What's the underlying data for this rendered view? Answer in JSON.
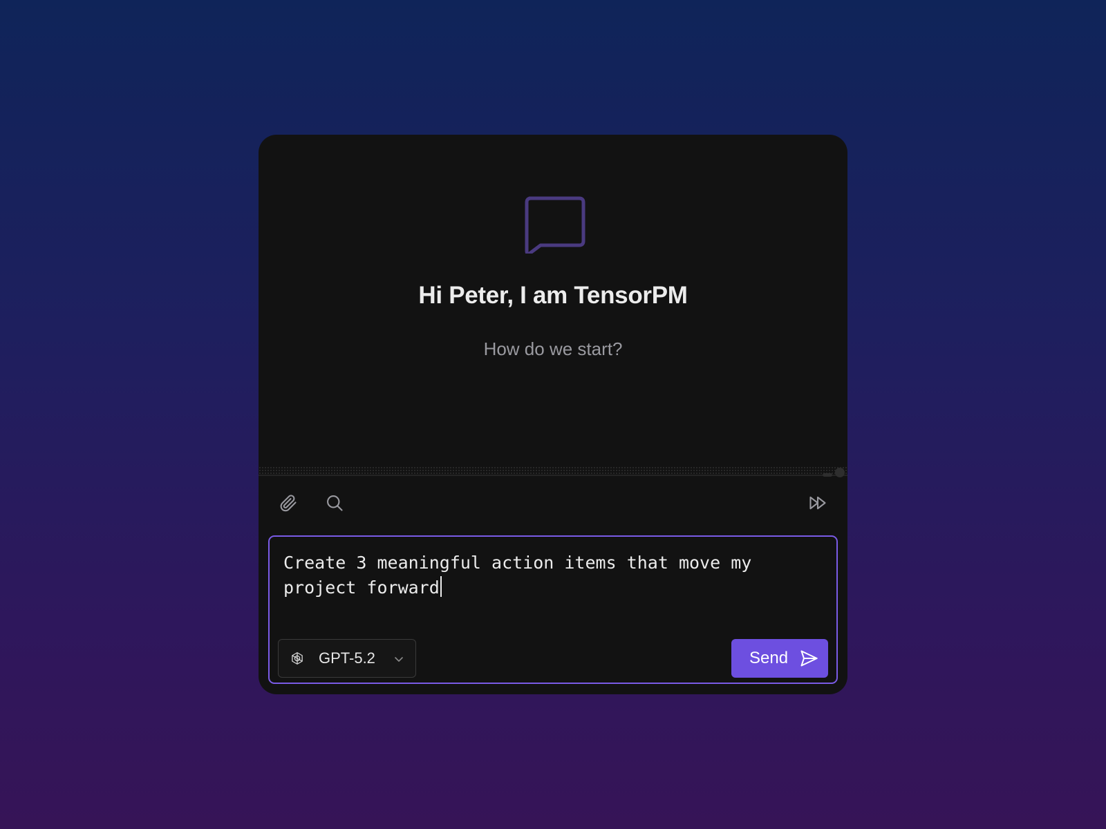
{
  "hero": {
    "title": "Hi Peter, I am TensorPM",
    "subtitle": "How do we start?",
    "icon": "chat-bubble-icon"
  },
  "toolbar": {
    "left_icons": [
      "paperclip-icon",
      "search-icon"
    ],
    "right_icons": [
      "fast-forward-icon"
    ]
  },
  "composer": {
    "value": "Create 3 meaningful action items that move my project forward",
    "model": {
      "label": "GPT-5.2",
      "icon": "openai-icon"
    },
    "send_label": "Send"
  },
  "colors": {
    "accent": "#6d4fe0",
    "composer_border": "#7a5be6",
    "card_bg": "#121212",
    "chat_icon": "#4a3a80"
  }
}
